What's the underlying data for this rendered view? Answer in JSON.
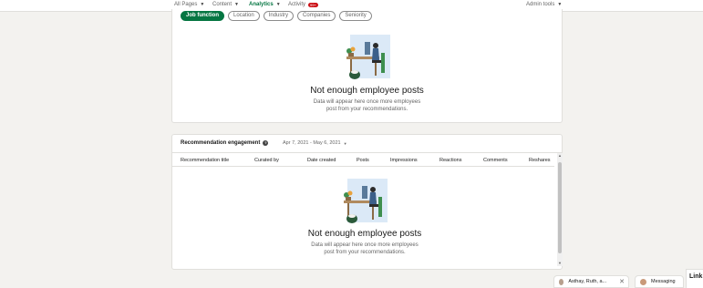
{
  "nav": {
    "items": [
      {
        "label": "All Pages",
        "active": false
      },
      {
        "label": "Content",
        "active": false
      },
      {
        "label": "Analytics",
        "active": true
      },
      {
        "label": "Activity",
        "active": false,
        "badge": "99+"
      },
      {
        "label": "Admin tools",
        "active": false
      }
    ]
  },
  "filters": {
    "pills": [
      "Job function",
      "Location",
      "Industry",
      "Companies",
      "Seniority"
    ],
    "selected": "Job function"
  },
  "empty_state_top": {
    "title": "Not enough employee posts",
    "body_line1": "Data will appear here once more employees",
    "body_line2": "post from your recommendations."
  },
  "engagement": {
    "title": "Recommendation engagement",
    "date_range": "Apr 7, 2021 - May 6, 2021",
    "columns": [
      "Recommendation title",
      "Curated by",
      "Date created",
      "Posts",
      "Impressions",
      "Reactions",
      "Comments",
      "Reshares"
    ],
    "empty_state": {
      "title": "Not enough employee posts",
      "body_line1": "Data will appear here once more employees",
      "body_line2": "post from your recommendations."
    }
  },
  "messaging": {
    "chat_label": "Asthay, Ruth, a...",
    "messaging_label": "Messaging",
    "side_label": "Link"
  },
  "colors": {
    "accent": "#057642",
    "background": "#f3f2ef",
    "badge": "#cc1016"
  }
}
